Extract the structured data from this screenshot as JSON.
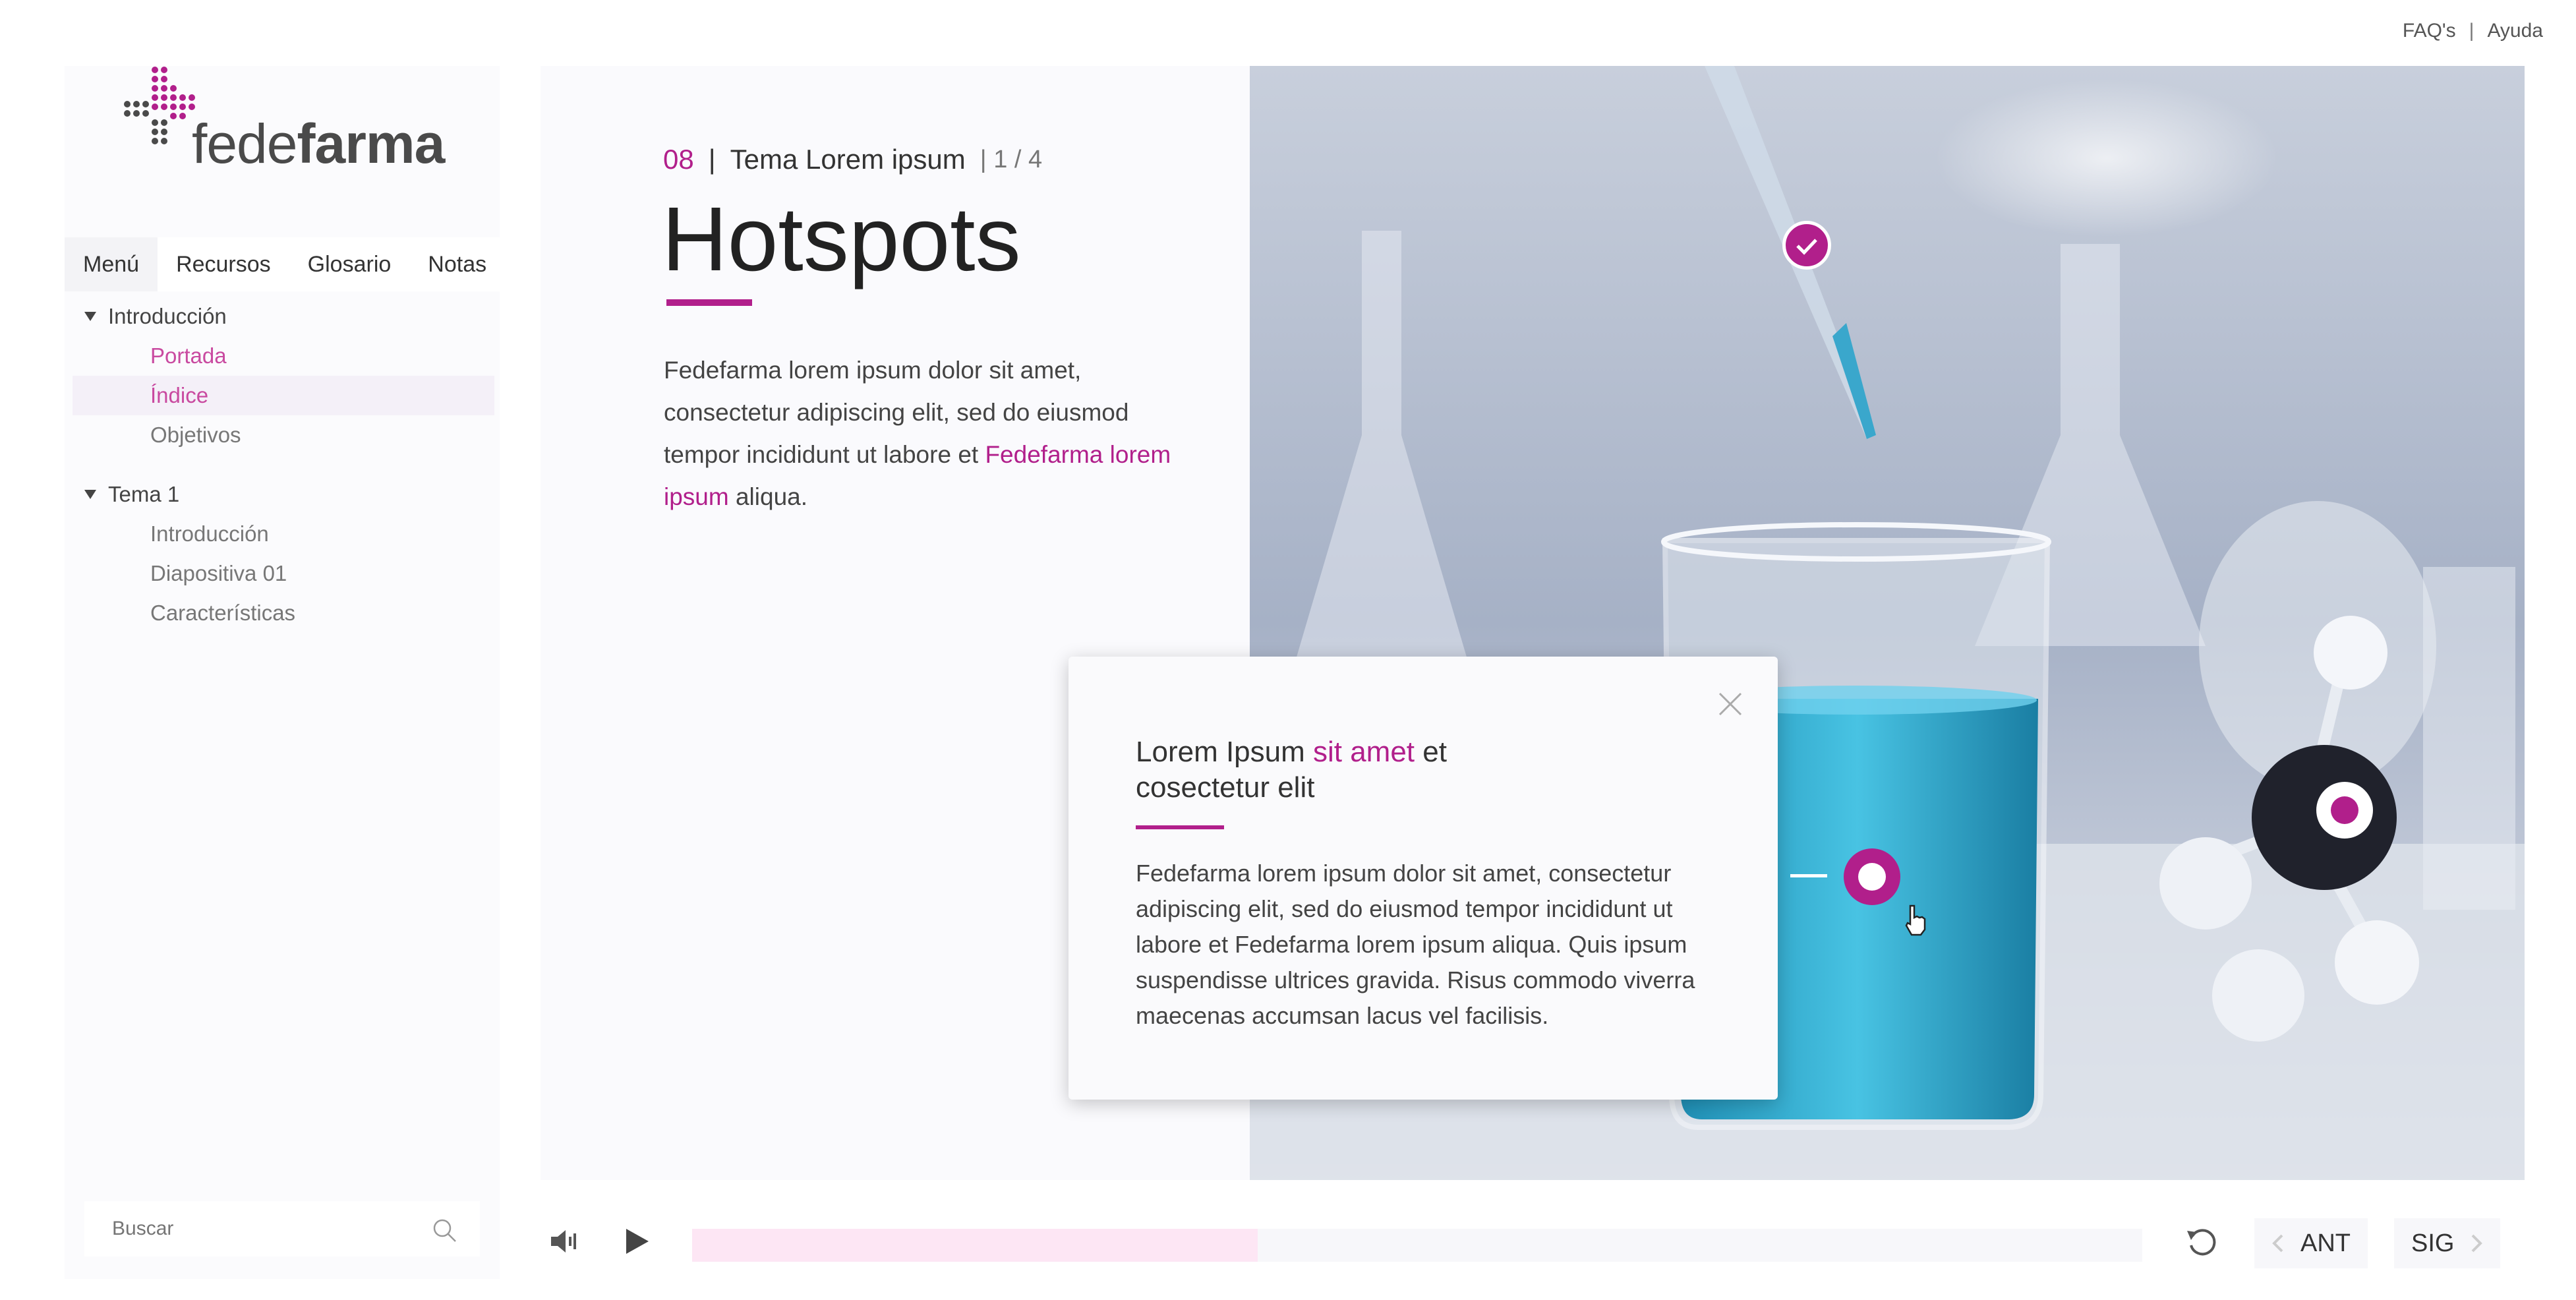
{
  "top_links": {
    "faq": "FAQ's",
    "separator": "|",
    "help": "Ayuda"
  },
  "brand": {
    "logo_light": "fede",
    "logo_bold": "farma",
    "accent_color": "#b11f8b"
  },
  "sidebar": {
    "tabs": [
      "Menú",
      "Recursos",
      "Glosario",
      "Notas"
    ],
    "active_tab": "Menú",
    "groups": [
      {
        "label": "Introducción",
        "items": [
          "Portada",
          "Índice",
          "Objetivos"
        ]
      },
      {
        "label": "Tema 1",
        "items": [
          "Introducción",
          "Diapositiva 01",
          "Características"
        ]
      }
    ],
    "search_placeholder": "Buscar"
  },
  "slide": {
    "number": "08",
    "sep": "|",
    "topic": "Tema Lorem ipsum",
    "page": "| 1 / 4",
    "title": "Hotspots",
    "para_before": "Fedefarma lorem ipsum dolor sit amet, consectetur adipiscing elit, sed do eiusmod tempor incididunt ut labore et ",
    "para_accent": "Fedefarma lorem ipsum",
    "para_after": " aliqua."
  },
  "popup": {
    "title_before": "Lorem Ipsum ",
    "title_accent": "sit amet",
    "title_after": " et cosectetur elit",
    "body": "Fedefarma lorem ipsum dolor sit amet, consectetur adipiscing elit, sed do eiusmod tempor incididunt ut labore et Fedefarma lorem ipsum aliqua. Quis ipsum suspendisse ultrices gravida. Risus commodo viverra maecenas accumsan lacus vel facilisis."
  },
  "controls": {
    "progress": 0.39,
    "prev_label": "ANT",
    "next_label": "SIG"
  }
}
